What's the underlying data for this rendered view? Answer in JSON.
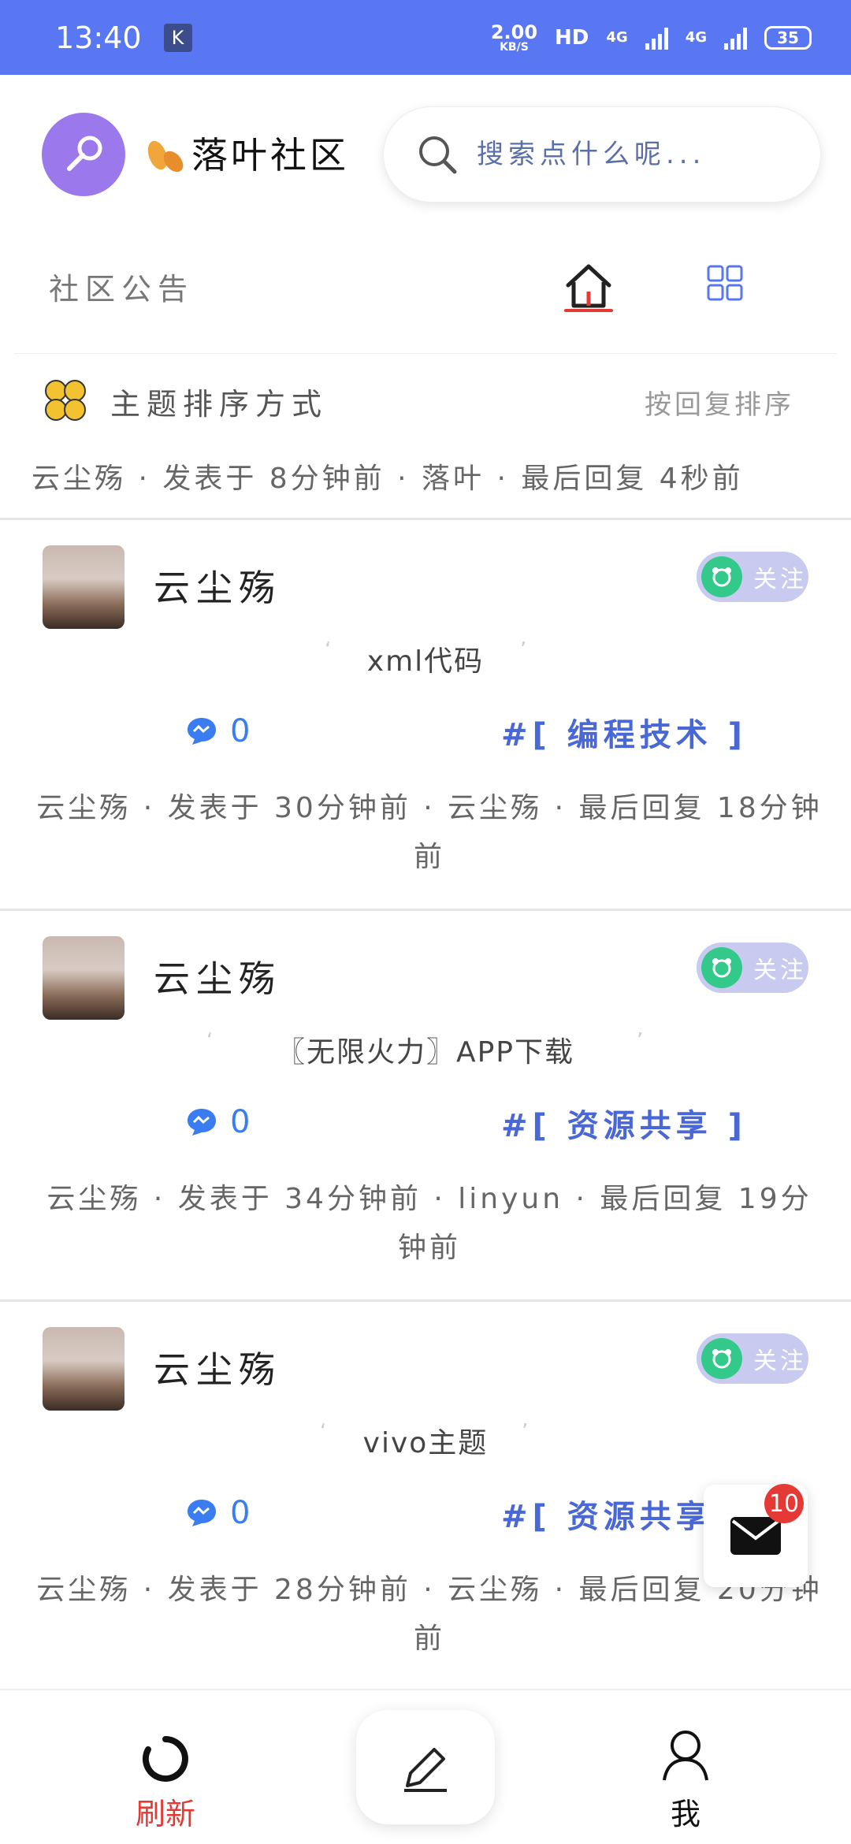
{
  "status_bar": {
    "time": "13:40",
    "k_icon": "K",
    "net_speed_value": "2.00",
    "net_speed_unit": "KB/S",
    "hd_label": "HD",
    "signal1_label": "4G",
    "signal2_label": "4G",
    "battery": "35"
  },
  "header": {
    "app_name": "落叶社区",
    "search_placeholder": "搜索点什么呢..."
  },
  "tabs": {
    "notice_label": "社区公告"
  },
  "sort": {
    "title": "主题排序方式",
    "mode": "按回复排序",
    "meta": "云尘殇 · 发表于 8分钟前 · 落叶 · 最后回复 4秒前"
  },
  "posts": [
    {
      "author": "云尘殇",
      "follow_label": "关注",
      "title": "xml代码",
      "comments": "0",
      "tag": "#[ 编程技术 ]",
      "meta": "云尘殇 · 发表于 30分钟前 · 云尘殇 · 最后回复 18分钟前"
    },
    {
      "author": "云尘殇",
      "follow_label": "关注",
      "title": "〖无限火力〗APP下载",
      "comments": "0",
      "tag": "#[ 资源共享 ]",
      "meta": "云尘殇 · 发表于 34分钟前 · linyun · 最后回复 19分钟前"
    },
    {
      "author": "云尘殇",
      "follow_label": "关注",
      "title": "vivo主题",
      "comments": "0",
      "tag": "#[ 资源共享",
      "meta": "云尘殇 · 发表于 28分钟前 · 云尘殇 · 最后回复 20分钟前"
    }
  ],
  "mail": {
    "badge": "10"
  },
  "bottom_nav": {
    "refresh_label": "刷新",
    "me_label": "我"
  },
  "colors": {
    "status_bar": "#5a77f3",
    "accent_blue": "#4a67d6",
    "red": "#e53935",
    "green": "#33c98a",
    "logo_purple": "#9b78ec"
  }
}
